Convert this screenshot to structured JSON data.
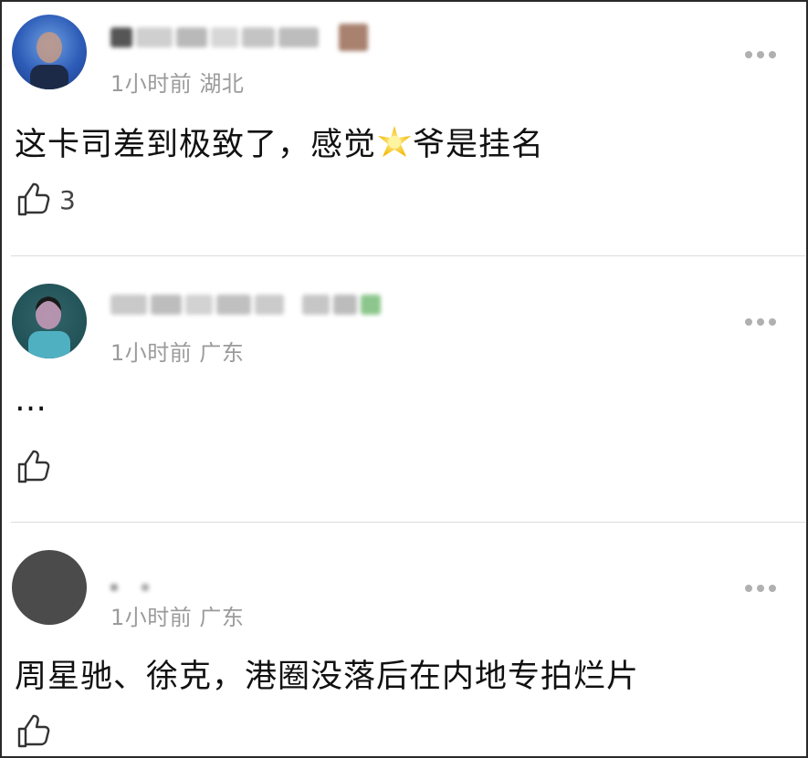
{
  "comments": [
    {
      "time_location": "1小时前 湖北",
      "text_before": "这卡司差到极致了，感觉",
      "emoji": "star-icon",
      "text_after": "爷是挂名",
      "likes": "3"
    },
    {
      "time_location": "1小时前 广东",
      "text": "…",
      "likes": ""
    },
    {
      "time_location": "1小时前 广东",
      "text": "周星驰、徐克，港圈没落后在内地专拍烂片",
      "likes": ""
    }
  ],
  "colors": {
    "meta_text": "#9b9b9b",
    "divider": "#dcdcdc",
    "more_dots": "#b0b0b0",
    "star": "#f5c518"
  }
}
